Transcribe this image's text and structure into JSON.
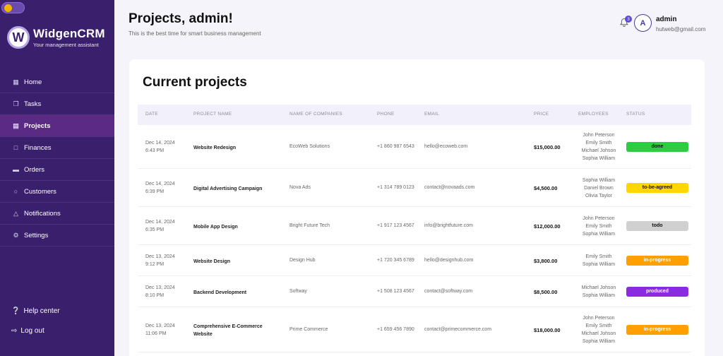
{
  "sidebar": {
    "brand": "WidgenCRM",
    "tagline": "Your management assistant",
    "logo_letter": "W",
    "items": [
      {
        "label": "Home",
        "icon": "home-icon"
      },
      {
        "label": "Tasks",
        "icon": "tasks-icon"
      },
      {
        "label": "Projects",
        "icon": "projects-icon",
        "active": true
      },
      {
        "label": "Finances",
        "icon": "folder-icon"
      },
      {
        "label": "Orders",
        "icon": "orders-icon"
      },
      {
        "label": "Customers",
        "icon": "user-icon"
      },
      {
        "label": "Notifications",
        "icon": "bell-icon"
      },
      {
        "label": "Settings",
        "icon": "gear-icon"
      }
    ],
    "help": "Help center",
    "logout": "Log out"
  },
  "header": {
    "title": "Projects, admin!",
    "subtitle": "This is the best time for smart business management",
    "notifications_count": "3",
    "avatar_letter": "A",
    "user_name": "admin",
    "user_email": "hutweb@gmail.com"
  },
  "projects": {
    "title": "Current projects",
    "columns": [
      "DATE",
      "PROJECT NAME",
      "NAME OF COMPANIES",
      "PHONE",
      "EMAIL",
      "PRICE",
      "EMPLOYEES",
      "STATUS"
    ],
    "rows": [
      {
        "date": "Dec 14, 2024",
        "time": "6:43 PM",
        "name": "Website Redesign",
        "company": "EcoWeb Solutions",
        "phone": "+1 860 987 6543",
        "email": "hello@ecoweb.com",
        "price": "$15,000.00",
        "employees": [
          "John Peterson",
          "Emily Smith",
          "Michael Johson",
          "Sophia William"
        ],
        "status": "done",
        "status_color": "#2ecc40",
        "status_text_color": "#111111"
      },
      {
        "date": "Dec 14, 2024",
        "time": "6:39 PM",
        "name": "Digital Advertising Campaign",
        "company": "Nova Ads",
        "phone": "+1 314 789 0123",
        "email": "contact@novaads.com",
        "price": "$4,500.00",
        "employees": [
          "Sophia William",
          "Daniel Brown",
          "Olivia Taylor"
        ],
        "status": "to-be-agreed",
        "status_color": "#ffd600",
        "status_text_color": "#111111"
      },
      {
        "date": "Dec 14, 2024",
        "time": "6:35 PM",
        "name": "Mobile App Design",
        "company": "Bright Future Tech",
        "phone": "+1 917 123 4567",
        "email": "info@brightfuture.com",
        "price": "$12,000.00",
        "employees": [
          "John Peterson",
          "Emily Smith",
          "Sophia William"
        ],
        "status": "todo",
        "status_color": "#d0d0d0",
        "status_text_color": "#111111"
      },
      {
        "date": "Dec 13, 2024",
        "time": "9:12 PM",
        "name": "Website Design",
        "company": "Design Hub",
        "phone": "+1 720 345 6789",
        "email": "hello@designhub.com",
        "price": "$3,800.00",
        "employees": [
          "Emily Smith",
          "Sophia William"
        ],
        "status": "in-progress",
        "status_color": "#ffa000",
        "status_text_color": "#ffffff"
      },
      {
        "date": "Dec 13, 2024",
        "time": "8:10 PM",
        "name": "Backend Development",
        "company": "Softway",
        "phone": "+1 508 123 4567",
        "email": "contact@softway.com",
        "price": "$8,500.00",
        "employees": [
          "Michael Johson",
          "Sophia William"
        ],
        "status": "produced",
        "status_color": "#8a2be2",
        "status_text_color": "#ffffff"
      },
      {
        "date": "Dec 13, 2024",
        "time": "11:06 PM",
        "name": "Comprehensive E-Commerce Website",
        "company": "Prime Commerce",
        "phone": "+1 659 456 7890",
        "email": "contact@primecommerce.com",
        "price": "$18,000.00",
        "employees": [
          "John Peterson",
          "Emily Smith",
          "Michael Johson",
          "Sophia William"
        ],
        "status": "in-progress",
        "status_color": "#ffa000",
        "status_text_color": "#ffffff"
      }
    ]
  }
}
